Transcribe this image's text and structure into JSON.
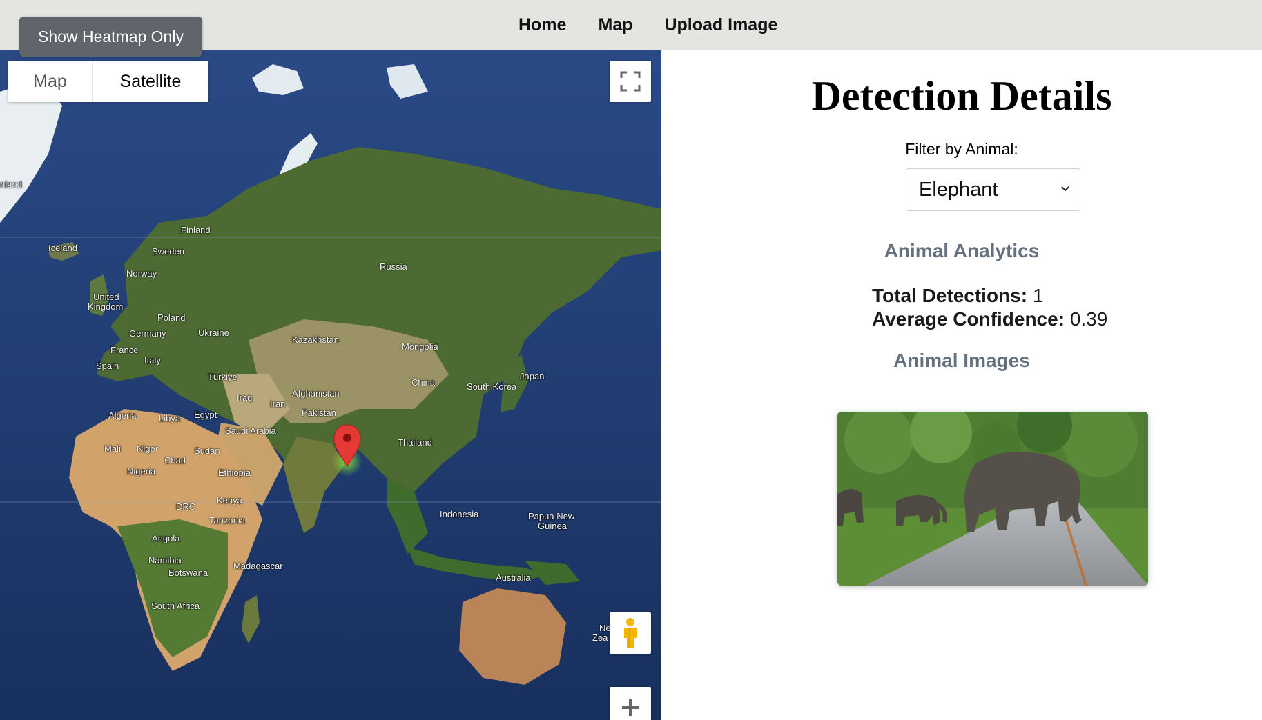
{
  "nav": {
    "links": [
      "Home",
      "Map",
      "Upload Image"
    ]
  },
  "heatmap_button": {
    "label": "Show Heatmap Only"
  },
  "map": {
    "type_controls": {
      "map_label": "Map",
      "satellite_label": "Satellite",
      "selected": "Satellite"
    },
    "labels": {
      "greenland": "nland",
      "iceland": "Iceland",
      "finland": "Finland",
      "sweden": "Sweden",
      "norway": "Norway",
      "uk_1": "United",
      "uk_2": "Kingdom",
      "poland": "Poland",
      "ukraine": "Ukraine",
      "germany": "Germany",
      "france": "France",
      "italy": "Italy",
      "spain": "Spain",
      "russia": "Russia",
      "kazakhstan": "Kazakhstan",
      "mongolia": "Mongolia",
      "turkiye": "Türkiye",
      "iraq": "Iraq",
      "iran": "Iran",
      "afghanistan": "Afghanistan",
      "pakistan": "Pakistan",
      "china": "China",
      "south_korea": "South Korea",
      "japan": "Japan",
      "algeria": "Algeria",
      "libya": "Libya",
      "egypt": "Egypt",
      "saudi": "Saudi Arabia",
      "mali": "Mali",
      "niger": "Niger",
      "chad": "Chad",
      "sudan": "Sudan",
      "nigeria": "Nigeria",
      "ethiopia": "Ethiopia",
      "thailand": "Thailand",
      "drc": "DRC",
      "kenya": "Kenya",
      "tanzania": "Tanzania",
      "indonesia": "Indonesia",
      "png_1": "Papua New",
      "png_2": "Guinea",
      "angola": "Angola",
      "namibia": "Namibia",
      "botswana": "Botswana",
      "madagascar": "Madagascar",
      "australia": "Australia",
      "south_africa": "South Africa",
      "nz_1": "Ne",
      "nz_2": "Zea"
    },
    "marker_location": "Sri Lanka / South India"
  },
  "details": {
    "title": "Detection Details",
    "filter_label": "Filter by Animal:",
    "selected_animal": "Elephant",
    "analytics_heading": "Animal Analytics",
    "total_label": "Total Detections:",
    "total_value": "1",
    "confidence_label": "Average Confidence:",
    "confidence_value": "0.39",
    "images_heading": "Animal Images"
  },
  "colors": {
    "nav_bg": "#e3e5e0",
    "heatmap_btn_bg": "#5f656b",
    "section_heading": "#66717f",
    "ocean": "#1e3a6d",
    "marker": "#e53935"
  }
}
